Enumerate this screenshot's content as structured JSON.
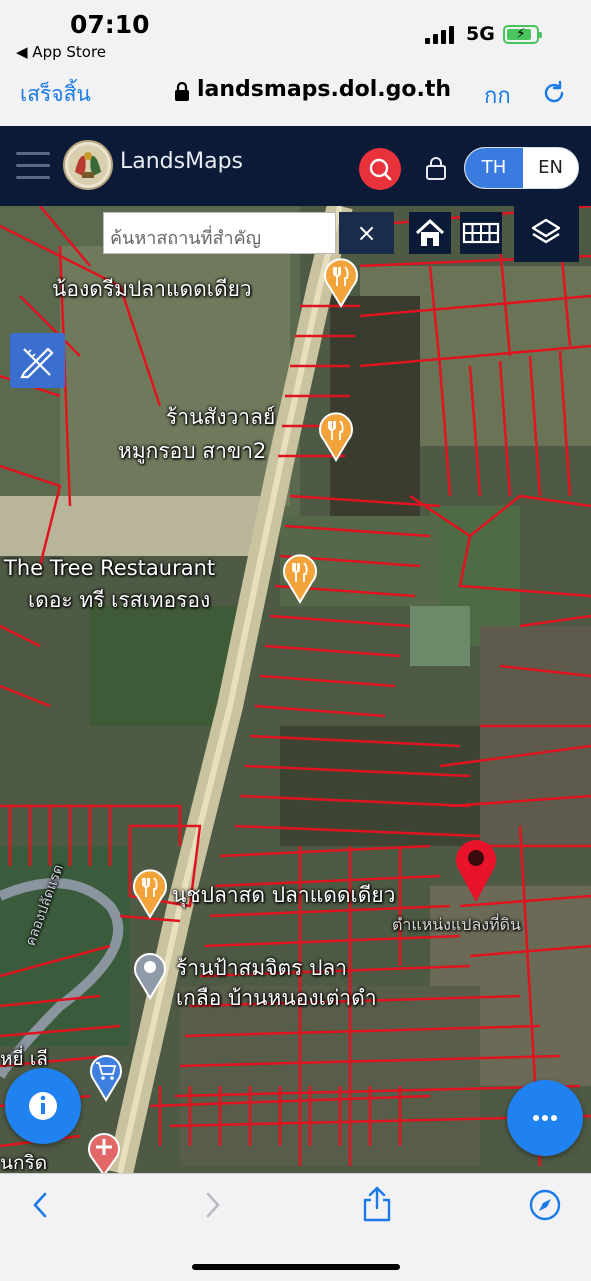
{
  "status_bar": {
    "time": "07:10",
    "back_app": "◀ App Store",
    "network": "5G"
  },
  "url_bar": {
    "done_label": "เสร็จสิ้น",
    "url": "landsmaps.dol.go.th",
    "text_size_label": "กก"
  },
  "app_header": {
    "brand": "LandsMaps",
    "lang_th": "TH",
    "lang_en": "EN",
    "active_lang": "TH"
  },
  "map": {
    "search_placeholder": "ค้นหาสถานที่สำคัญ",
    "clear_label": "×",
    "pois": [
      {
        "lines": [
          "น้องดรีมปลาแดดเดียว"
        ],
        "icon": "restaurant-icon"
      },
      {
        "lines": [
          "ร้านสังวาลย์",
          "หมูกรอบ สาขา2"
        ],
        "icon": "restaurant-icon"
      },
      {
        "lines": [
          "The Tree Restaurant",
          "เดอะ ทรี เรสเทอรอง"
        ],
        "icon": "restaurant-icon"
      },
      {
        "lines": [
          "นุชปลาสด ปลาแดดเดียว"
        ],
        "icon": "restaurant-icon"
      },
      {
        "lines": [
          "ร้านป้าสมจิตร ปลา",
          "เกลือ บ้านหนองเต่าดำ"
        ],
        "icon": "place-icon"
      }
    ],
    "selected_pin_label": "ตำแหน่งแปลงที่ดิน",
    "minor_labels": [
      "คลองปลัดแรด",
      "หยี่ เลี",
      "นกริด"
    ],
    "colors": {
      "parcel_line": "#e0141e",
      "road": "#d8d2a8",
      "fab": "#1f82f0",
      "header": "#0b1a36",
      "search_btn": "#e8323c"
    }
  }
}
